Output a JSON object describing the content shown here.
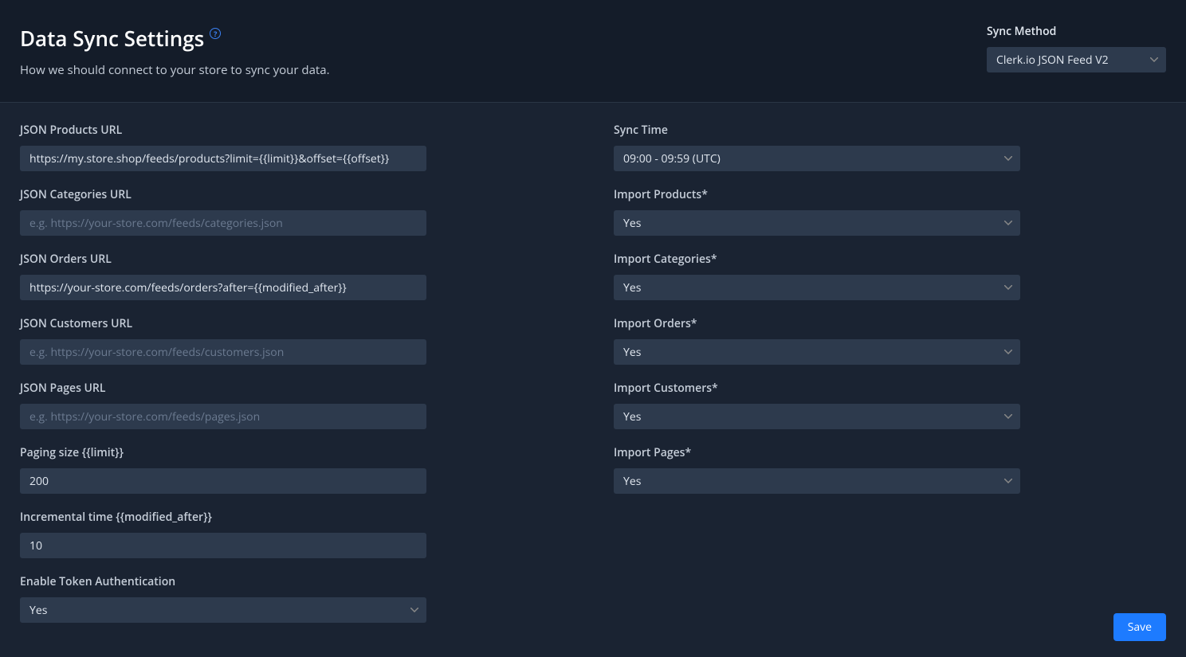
{
  "header": {
    "title": "Data Sync Settings",
    "subtitle": "How we should connect to your store to sync your data.",
    "help_icon_glyph": "?",
    "sync_method_label": "Sync Method",
    "sync_method_value": "Clerk.io JSON Feed V2"
  },
  "left": {
    "products_url": {
      "label": "JSON Products URL",
      "value": "https://my.store.shop/feeds/products?limit={{limit}}&offset={{offset}}",
      "placeholder": ""
    },
    "categories_url": {
      "label": "JSON Categories URL",
      "value": "",
      "placeholder": "e.g. https://your-store.com/feeds/categories.json"
    },
    "orders_url": {
      "label": "JSON Orders URL",
      "value": "https://your-store.com/feeds/orders?after={{modified_after}}",
      "placeholder": ""
    },
    "customers_url": {
      "label": "JSON Customers URL",
      "value": "",
      "placeholder": "e.g. https://your-store.com/feeds/customers.json"
    },
    "pages_url": {
      "label": "JSON Pages URL",
      "value": "",
      "placeholder": "e.g. https://your-store.com/feeds/pages.json"
    },
    "paging_size": {
      "label": "Paging size {{limit}}",
      "value": "200"
    },
    "incremental_time": {
      "label": "Incremental time {{modified_after}}",
      "value": "10"
    },
    "token_auth": {
      "label": "Enable Token Authentication",
      "value": "Yes"
    }
  },
  "right": {
    "sync_time": {
      "label": "Sync Time",
      "value": "09:00 - 09:59 (UTC)"
    },
    "import_products": {
      "label": "Import Products*",
      "value": "Yes"
    },
    "import_categories": {
      "label": "Import Categories*",
      "value": "Yes"
    },
    "import_orders": {
      "label": "Import Orders*",
      "value": "Yes"
    },
    "import_customers": {
      "label": "Import Customers*",
      "value": "Yes"
    },
    "import_pages": {
      "label": "Import Pages*",
      "value": "Yes"
    }
  },
  "footer": {
    "save_label": "Save"
  }
}
